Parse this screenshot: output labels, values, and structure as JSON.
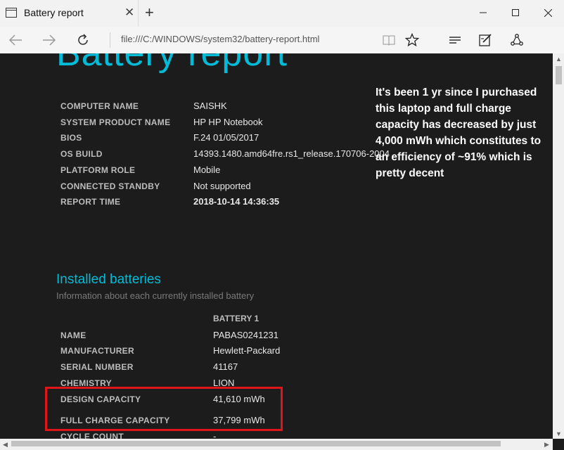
{
  "browser": {
    "tab_title": "Battery report",
    "address": "file:///C:/WINDOWS/system32/battery-report.html"
  },
  "report": {
    "title": "Battery report",
    "system_info": [
      {
        "label": "COMPUTER NAME",
        "value": "SAISHK"
      },
      {
        "label": "SYSTEM PRODUCT NAME",
        "value": "HP HP Notebook"
      },
      {
        "label": "BIOS",
        "value": "F.24 01/05/2017"
      },
      {
        "label": "OS BUILD",
        "value": "14393.1480.amd64fre.rs1_release.170706-2004"
      },
      {
        "label": "PLATFORM ROLE",
        "value": "Mobile"
      },
      {
        "label": "CONNECTED STANDBY",
        "value": "Not supported"
      },
      {
        "label": "REPORT TIME",
        "value": "2018-10-14  14:36:35"
      }
    ],
    "installed": {
      "title": "Installed batteries",
      "subtitle": "Information about each currently installed battery",
      "column_header": "BATTERY 1",
      "rows": [
        {
          "label": "NAME",
          "value": "PABAS0241231"
        },
        {
          "label": "MANUFACTURER",
          "value": "Hewlett-Packard"
        },
        {
          "label": "SERIAL NUMBER",
          "value": "41167"
        },
        {
          "label": "CHEMISTRY",
          "value": "LION"
        },
        {
          "label": "DESIGN CAPACITY",
          "value": "41,610 mWh"
        },
        {
          "label": "FULL CHARGE CAPACITY",
          "value": "37,799 mWh"
        },
        {
          "label": "CYCLE COUNT",
          "value": "-"
        }
      ]
    }
  },
  "annotation": {
    "text": "It's been 1 yr since I purchased this laptop and full charge capacity has decreased by just 4,000 mWh which constitutes to an efficiency of  ~91% which is pretty decent"
  },
  "colors": {
    "accent": "#00bcd8",
    "highlight_box": "#e0151a",
    "page_bg": "#1c1c1c"
  }
}
